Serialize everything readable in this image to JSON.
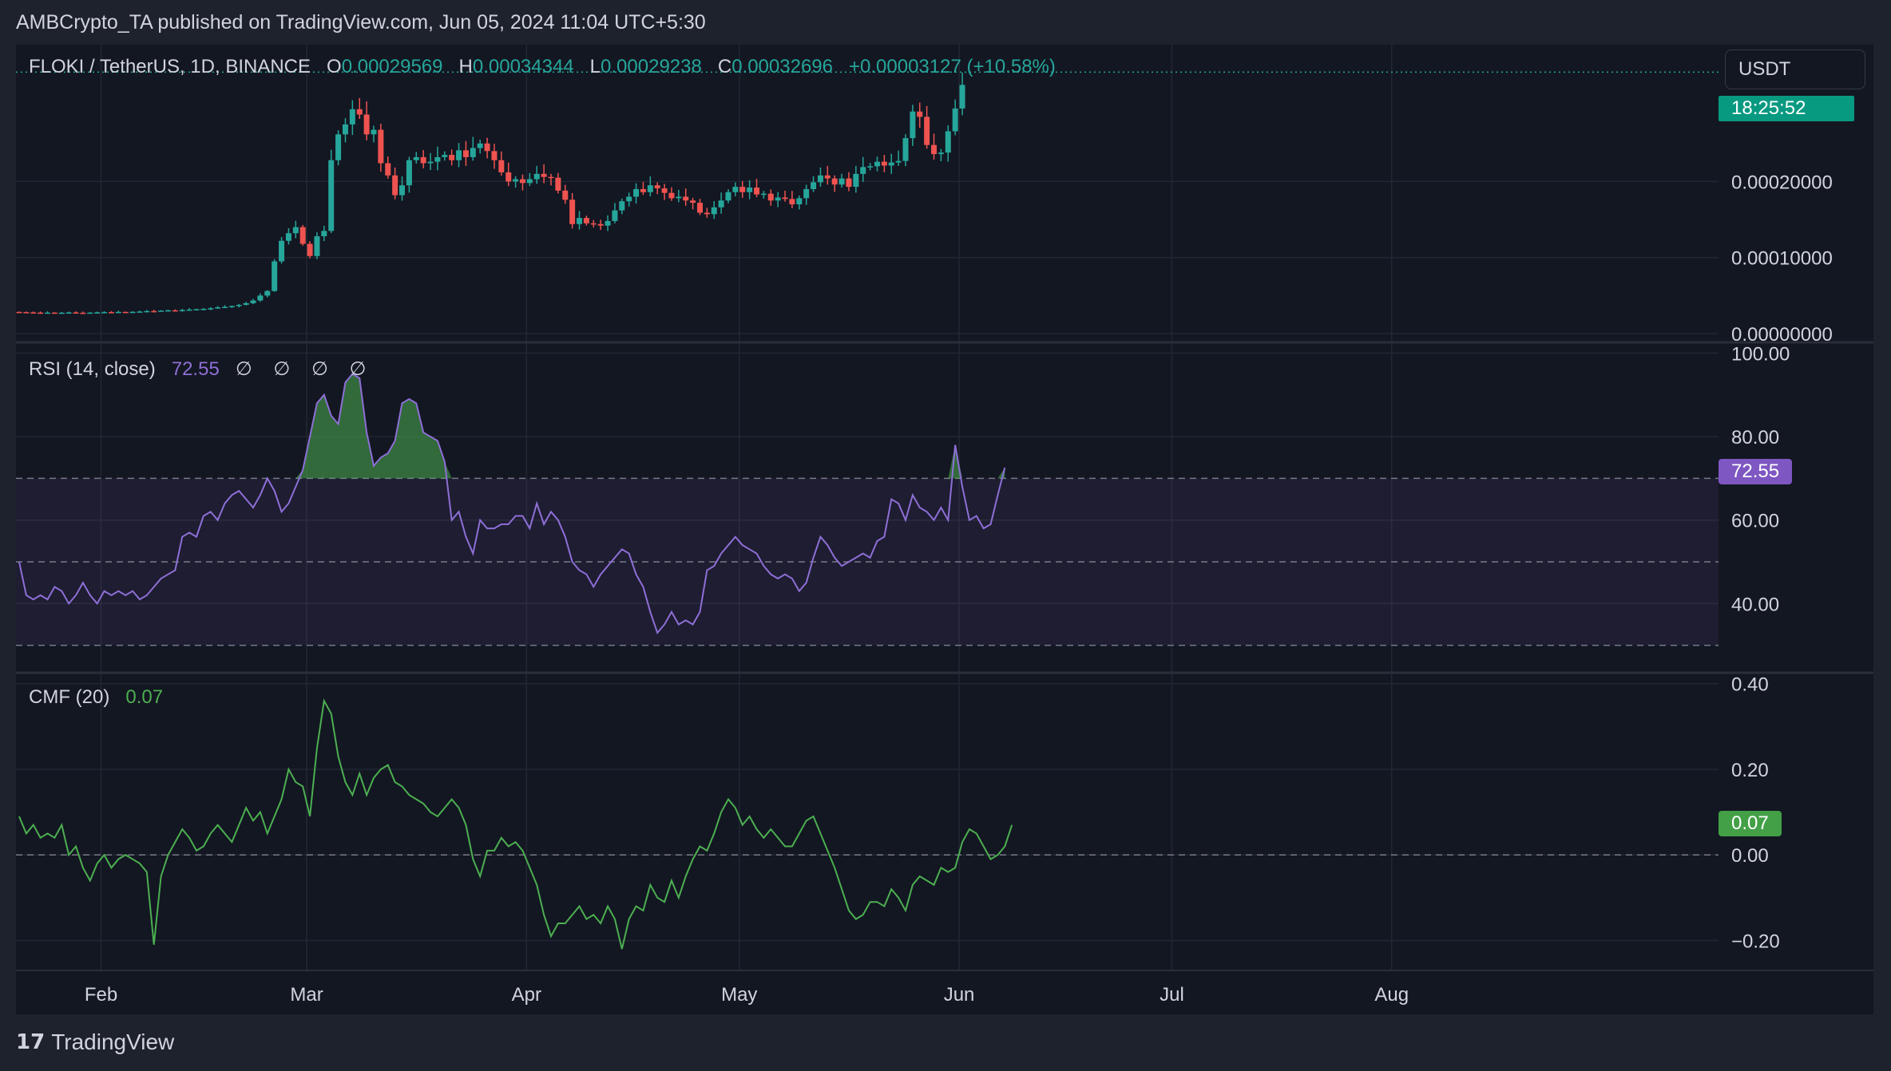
{
  "header": {
    "publish_line": "AMBCrypto_TA published on TradingView.com, Jun 05, 2024 11:04 UTC+5:30"
  },
  "main_legend": {
    "symbol": "FLOKI / TetherUS, 1D, BINANCE",
    "o_label": "O",
    "o_value": "0.00029569",
    "h_label": "H",
    "h_value": "0.00034344",
    "l_label": "L",
    "l_value": "0.00029238",
    "c_label": "C",
    "c_value": "0.00032696",
    "change": "+0.00003127 (+10.58%)"
  },
  "currency_selector": "USDT",
  "countdown": "18:25:52",
  "rsi_legend": {
    "label": "RSI (14, close)",
    "value": "72.55",
    "dots": "∅ ∅ ∅ ∅"
  },
  "cmf_legend": {
    "label": "CMF (20)",
    "value": "0.07"
  },
  "rsi_tag": "72.55",
  "cmf_tag": "0.07",
  "footer": {
    "brand": "TradingView",
    "logo_icon": "tradingview-logo-icon"
  },
  "colors": {
    "up": "#26a69a",
    "down": "#ef5350",
    "rsi": "#8e6fd6",
    "cmf": "#4caf50",
    "background": "#131722",
    "grid": "#232733",
    "text": "#d1d4dc"
  },
  "chart_data": [
    {
      "type": "candlestick",
      "title": "FLOKI / TetherUS, 1D, BINANCE",
      "x_labels": [
        "Feb",
        "Mar",
        "Apr",
        "May",
        "Jun",
        "Jul",
        "Aug"
      ],
      "y_ticks": [
        "0.00020000",
        "0.00010000",
        "0.00000000"
      ],
      "ylim": [
        0,
        0.00034
      ],
      "grid": true,
      "start_date": "2024-01-20",
      "closes": [
        2.82e-05,
        2.79e-05,
        2.76e-05,
        2.74e-05,
        2.76e-05,
        2.73e-05,
        2.75e-05,
        2.78e-05,
        2.74e-05,
        2.73e-05,
        2.76e-05,
        2.8e-05,
        2.82e-05,
        2.79e-05,
        2.85e-05,
        2.84e-05,
        2.86e-05,
        2.9e-05,
        2.96e-05,
        2.94e-05,
        3.02e-05,
        3.06e-05,
        3.04e-05,
        3.1e-05,
        3.16e-05,
        3.2e-05,
        3.25e-05,
        3.33e-05,
        3.45e-05,
        3.52e-05,
        3.62e-05,
        3.78e-05,
        4e-05,
        4.35e-05,
        5e-05,
        5.6e-05,
        9.5e-05,
        0.000122,
        0.000132,
        0.00014,
        0.000118,
        0.000102,
        0.000128,
        0.000135,
        0.000228,
        0.000262,
        0.000275,
        0.000295,
        0.000288,
        0.000262,
        0.000268,
        0.000224,
        0.000208,
        0.000182,
        0.000195,
        0.000228,
        0.000232,
        0.000224,
        0.000226,
        0.000232,
        0.000235,
        0.000228,
        0.000241,
        0.000232,
        0.000244,
        0.00025,
        0.00024,
        0.000228,
        0.000212,
        0.0002,
        0.000203,
        0.000198,
        0.000203,
        0.00021,
        0.000206,
        0.000205,
        0.000188,
        0.000176,
        0.000144,
        0.000152,
        0.000145,
        0.000144,
        0.000142,
        0.000148,
        0.000162,
        0.000174,
        0.00018,
        0.00019,
        0.000186,
        0.000195,
        0.000191,
        0.000185,
        0.000178,
        0.00018,
        0.000175,
        0.000172,
        0.000159,
        0.000157,
        0.000166,
        0.000175,
        0.000186,
        0.000193,
        0.000186,
        0.000192,
        0.000183,
        0.000184,
        0.000175,
        0.000179,
        0.000177,
        0.00017,
        0.000178,
        0.00019,
        0.000199,
        0.000208,
        0.000204,
        0.000196,
        0.000204,
        0.000193,
        0.00021,
        0.000219,
        0.00022,
        0.000226,
        0.000221,
        0.000225,
        0.000227,
        0.000257,
        0.000292,
        0.000285,
        0.000248,
        0.000236,
        0.000238,
        0.000266,
        0.000296,
        0.000327
      ]
    },
    {
      "type": "line",
      "title": "RSI (14, close)",
      "y_ticks": [
        "100.00",
        "80.00",
        "60.00",
        "40.00"
      ],
      "ylim": [
        20,
        100
      ],
      "bands": {
        "upper": 70,
        "middle": 50,
        "lower": 30
      },
      "values": [
        50,
        42,
        41,
        42,
        41,
        44,
        43,
        40,
        42,
        45,
        42,
        40,
        43,
        42,
        43,
        42,
        43,
        41,
        42,
        44,
        46,
        47,
        48,
        56,
        57,
        56,
        61,
        62,
        60,
        64,
        66,
        67,
        65,
        63,
        66,
        70,
        67,
        62,
        64,
        68,
        72,
        80,
        88,
        90,
        85,
        83,
        93,
        95,
        94,
        81,
        73,
        75,
        76,
        79,
        88,
        89,
        88,
        81,
        80,
        79,
        74,
        60,
        62,
        56,
        52,
        60,
        58,
        58,
        59,
        59,
        61,
        61,
        58,
        64,
        59,
        62,
        60,
        56,
        50,
        48,
        47,
        44,
        47,
        49,
        51,
        53,
        52,
        47,
        44,
        38,
        33,
        35,
        38,
        35,
        36,
        35,
        38,
        48,
        49,
        52,
        54,
        56,
        54,
        53,
        52,
        49,
        47,
        46,
        47,
        46,
        43,
        45,
        51,
        56,
        54,
        51,
        49,
        50,
        51,
        52,
        51,
        55,
        56,
        65,
        64,
        60,
        66,
        63,
        62,
        60,
        63,
        60,
        78,
        68,
        60,
        61,
        58,
        59,
        66,
        72.55
      ],
      "color": "#8e6fd6"
    },
    {
      "type": "line",
      "title": "CMF (20)",
      "y_ticks": [
        "0.40",
        "0.20",
        "0.00",
        "−0.20"
      ],
      "ylim": [
        -0.3,
        0.42
      ],
      "zero_line": 0,
      "values": [
        0.09,
        0.05,
        0.07,
        0.04,
        0.05,
        0.04,
        0.07,
        0.0,
        0.02,
        -0.03,
        -0.06,
        -0.02,
        0.0,
        -0.03,
        -0.01,
        0.0,
        -0.01,
        -0.02,
        -0.04,
        -0.21,
        -0.05,
        0.0,
        0.03,
        0.06,
        0.04,
        0.01,
        0.02,
        0.05,
        0.07,
        0.05,
        0.03,
        0.07,
        0.11,
        0.08,
        0.1,
        0.05,
        0.09,
        0.13,
        0.2,
        0.17,
        0.16,
        0.09,
        0.25,
        0.36,
        0.33,
        0.23,
        0.17,
        0.14,
        0.19,
        0.14,
        0.18,
        0.2,
        0.21,
        0.17,
        0.16,
        0.14,
        0.13,
        0.12,
        0.1,
        0.09,
        0.11,
        0.13,
        0.11,
        0.07,
        -0.01,
        -0.05,
        0.01,
        0.01,
        0.04,
        0.02,
        0.03,
        0.01,
        -0.03,
        -0.07,
        -0.14,
        -0.19,
        -0.16,
        -0.16,
        -0.14,
        -0.12,
        -0.15,
        -0.14,
        -0.16,
        -0.12,
        -0.15,
        -0.22,
        -0.15,
        -0.12,
        -0.13,
        -0.07,
        -0.1,
        -0.11,
        -0.06,
        -0.1,
        -0.05,
        -0.01,
        0.02,
        0.01,
        0.05,
        0.1,
        0.13,
        0.11,
        0.07,
        0.09,
        0.06,
        0.04,
        0.06,
        0.04,
        0.02,
        0.02,
        0.05,
        0.08,
        0.09,
        0.05,
        0.01,
        -0.03,
        -0.08,
        -0.13,
        -0.15,
        -0.14,
        -0.11,
        -0.11,
        -0.12,
        -0.08,
        -0.1,
        -0.13,
        -0.07,
        -0.05,
        -0.06,
        -0.07,
        -0.03,
        -0.04,
        -0.03,
        0.03,
        0.06,
        0.05,
        0.02,
        -0.01,
        0.0,
        0.02,
        0.07
      ],
      "color": "#4caf50"
    }
  ]
}
